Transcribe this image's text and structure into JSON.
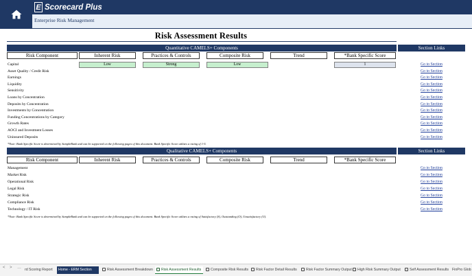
{
  "header": {
    "app_name": "Scorecard Plus",
    "logo_letter": "E",
    "subtitle": "Enterprise Risk Management",
    "home_icon": "home-icon"
  },
  "page_title": "Risk Assessment Results",
  "quantitative": {
    "section_title": "Quantitative CAMELS+ Components",
    "links_title": "Section Links",
    "columns": [
      "Risk Component",
      "Inherent Risk",
      "Practices & Controls",
      "Composite Risk",
      "Trend",
      "*Bank Specific Score"
    ],
    "rows": [
      {
        "label": "Capital",
        "inherent": "Low",
        "practices": "Strong",
        "composite": "Low",
        "trend": "",
        "score": "1",
        "link": "Go to Section"
      },
      {
        "label": "Asset Quality / Credit Risk",
        "link": "Go to Section"
      },
      {
        "label": "Earnings",
        "link": "Go to Section"
      },
      {
        "label": "Liquidity",
        "link": "Go to Section"
      },
      {
        "label": "Sensitivity",
        "link": "Go to Section"
      },
      {
        "label": "Loans by Concentration",
        "link": "Go to Section"
      },
      {
        "label": "Deposits by Concentration",
        "link": "Go to Section"
      },
      {
        "label": "Investments by Concentration",
        "link": "Go to Section"
      },
      {
        "label": "Funding Concentrations by Category",
        "link": "Go to Section"
      },
      {
        "label": "Growth Rates",
        "link": "Go to Section"
      },
      {
        "label": "AOCI and Investment Losses",
        "link": "Go to Section"
      },
      {
        "label": "Uninsured Deposits",
        "link": "Go to Section"
      }
    ],
    "note": "*Note: Bank Specific Score is determined by SampleBank and can be supported on the following pages of this document. Bank Specific Score utilizes a rating of 1-5."
  },
  "qualitative": {
    "section_title": "Qualitative CAMELS+ Components",
    "links_title": "Section Links",
    "columns": [
      "Risk Component",
      "Inherent Risk",
      "Practices & Controls",
      "Composite Risk",
      "Trend",
      "*Bank Specific Score"
    ],
    "rows": [
      {
        "label": "Management",
        "link": "Go to Section"
      },
      {
        "label": "Market Risk",
        "link": "Go to Section"
      },
      {
        "label": "Operational Risk",
        "link": "Go to Section"
      },
      {
        "label": "Legal Risk",
        "link": "Go to Section"
      },
      {
        "label": "Strategic Risk",
        "link": "Go to Section"
      },
      {
        "label": "Compliance Risk",
        "link": "Go to Section"
      },
      {
        "label": "Technology / IT Risk",
        "link": "Go to Section"
      }
    ],
    "note": "*Note: Bank Specific Score is determined by SampleBank and can be supported on the following pages of this document. Bank Specific Score utilizes a rating of Satisfactory (S), Outstanding (O), Unsatisfactory (U)."
  },
  "tabs": {
    "nav": [
      "<",
      ">",
      "…"
    ],
    "items": [
      {
        "label": "rd Scoring Report"
      },
      {
        "label": "Home - ERM Section"
      },
      {
        "label": "Risk Assessment Breakdown"
      },
      {
        "label": "Risk Assessment Results"
      },
      {
        "label": "Composite Risk Results"
      },
      {
        "label": "Risk Factor Detail Results"
      },
      {
        "label": "Risk Factor Summary Output"
      },
      {
        "label": "High Risk Summary Output"
      },
      {
        "label": "Self Assessment Results"
      },
      {
        "label": "FinPro Glob"
      }
    ]
  },
  "colors": {
    "navy": "#1f3864",
    "green_cell": "#c6efce",
    "score_cell": "#dde3ed",
    "link": "#1f3e9a"
  }
}
